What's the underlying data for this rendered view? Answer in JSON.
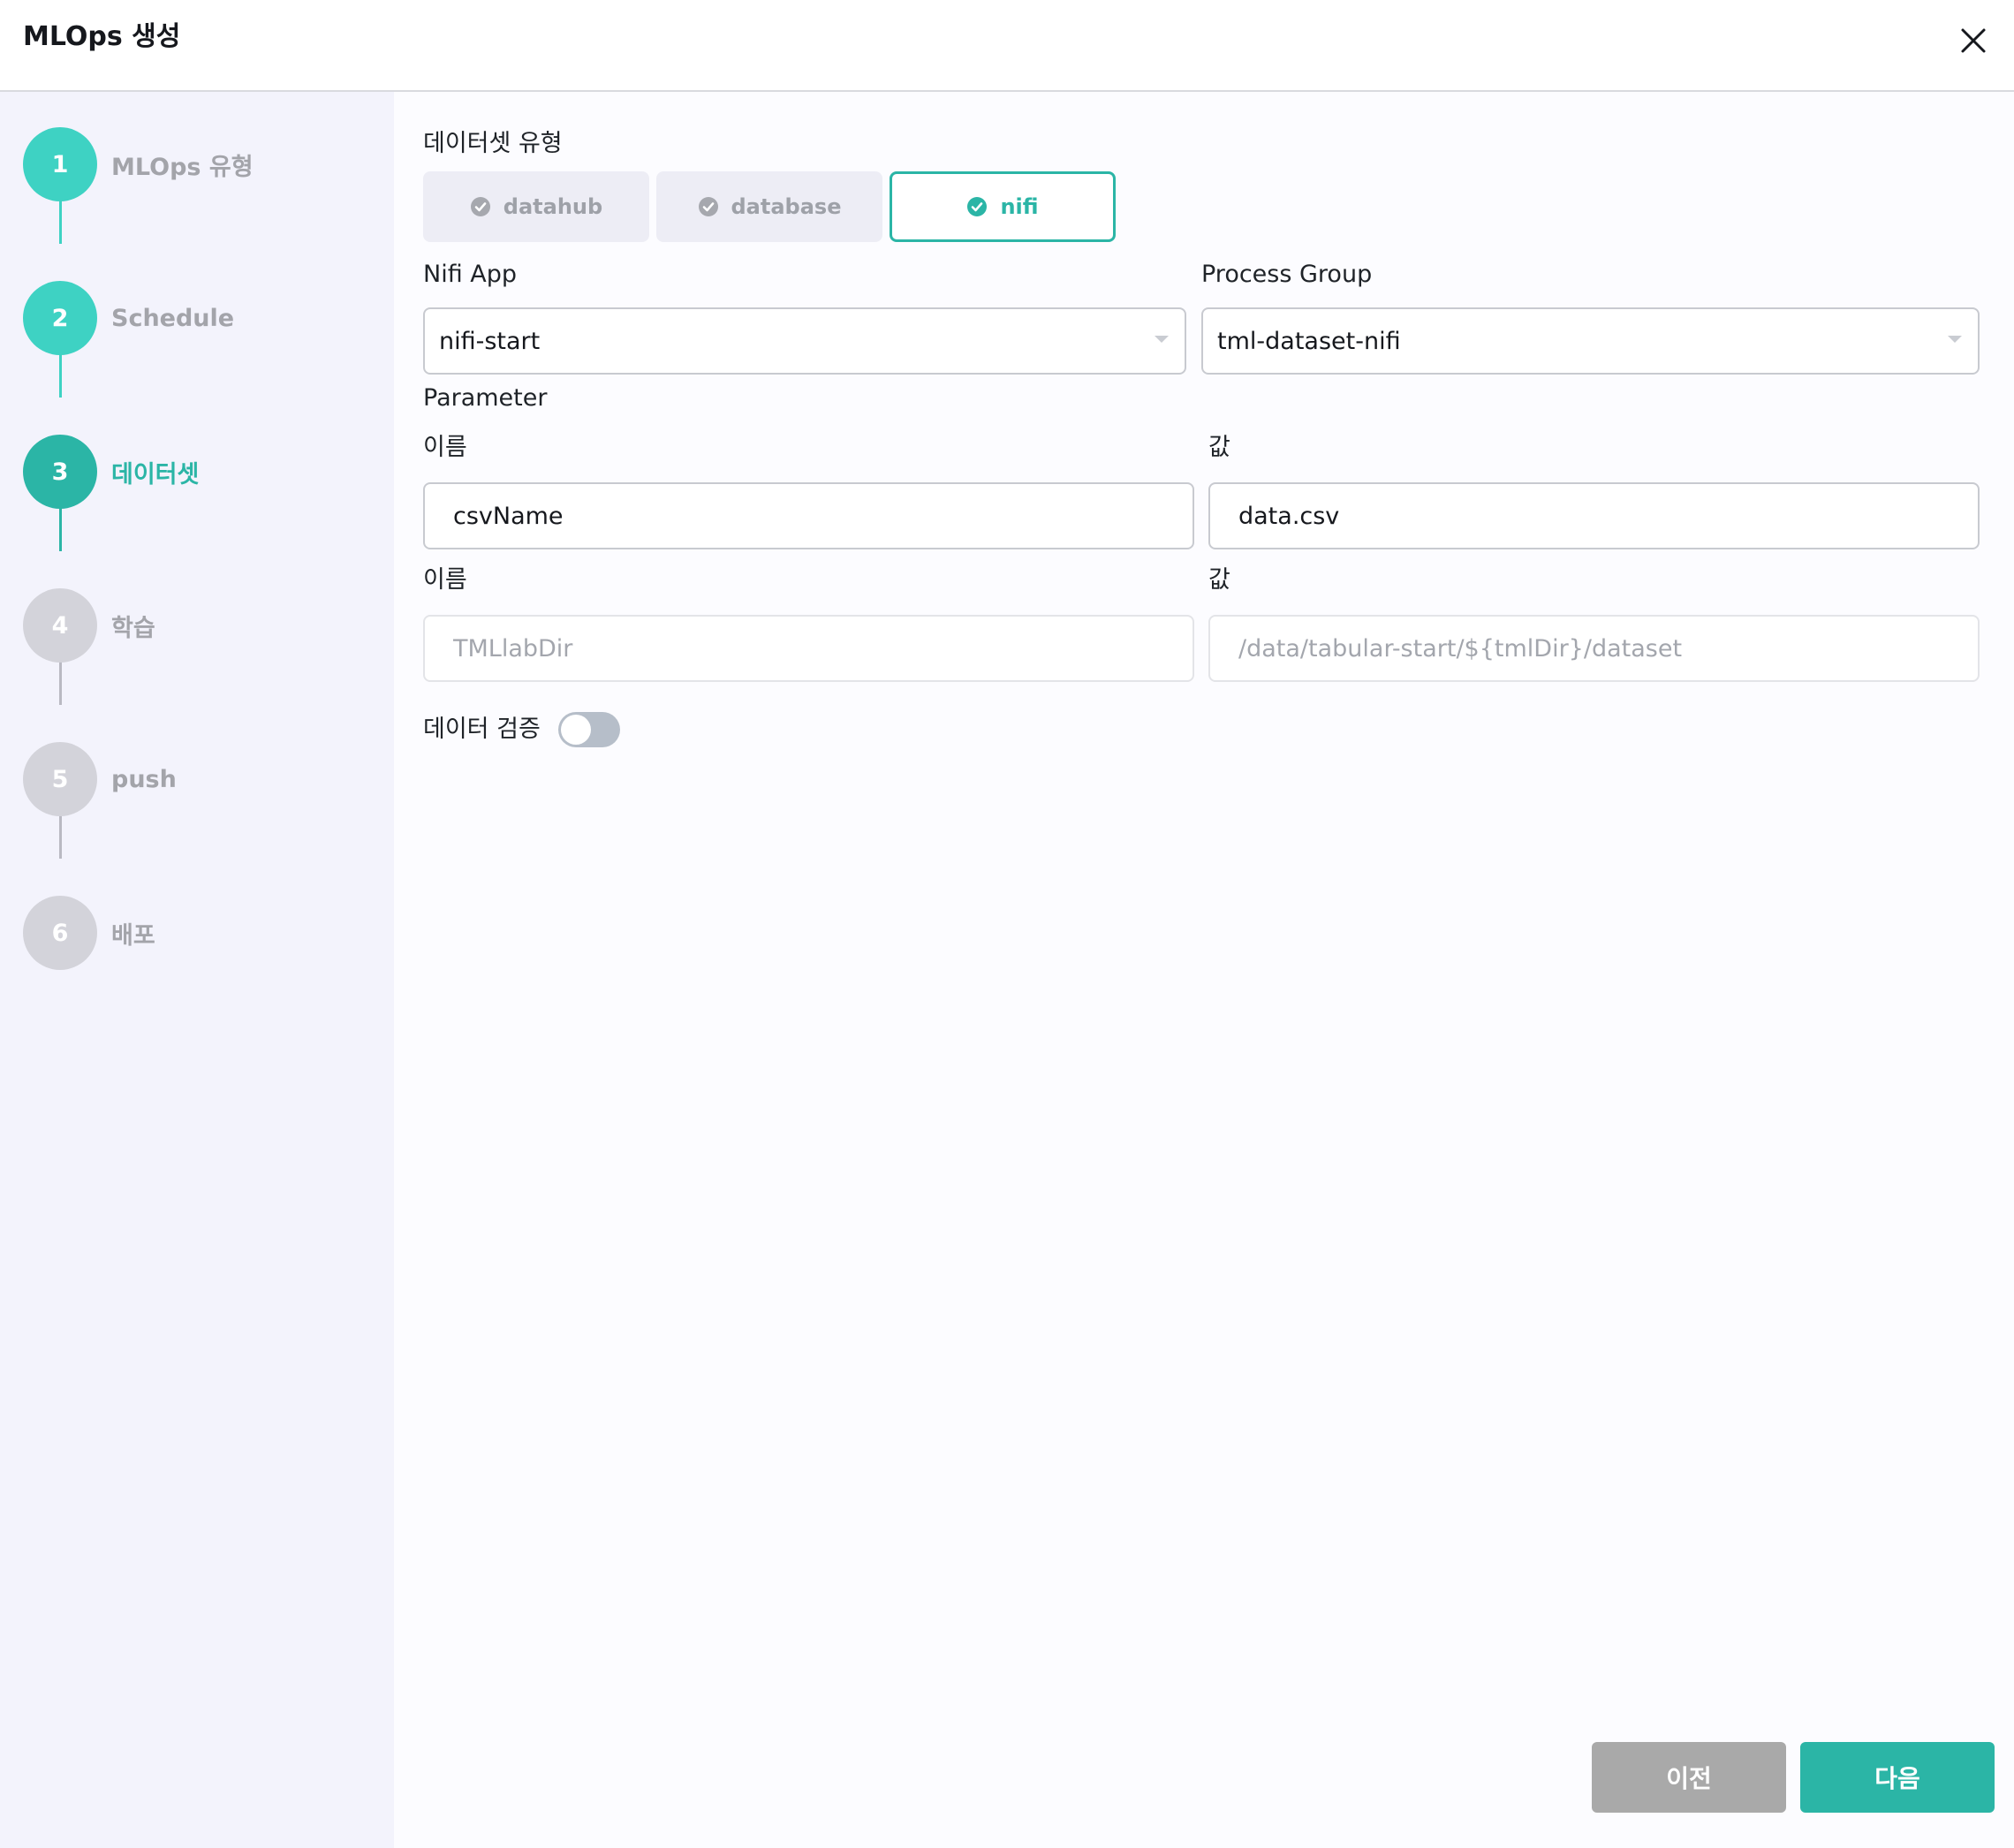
{
  "header": {
    "title": "MLOps 생성"
  },
  "steps": [
    {
      "number": "1",
      "label": "MLOps 유형",
      "status": "completed"
    },
    {
      "number": "2",
      "label": "Schedule",
      "status": "completed"
    },
    {
      "number": "3",
      "label": "데이터셋",
      "status": "active"
    },
    {
      "number": "4",
      "label": "학습",
      "status": "pending"
    },
    {
      "number": "5",
      "label": "push",
      "status": "pending"
    },
    {
      "number": "6",
      "label": "배포",
      "status": "pending"
    }
  ],
  "dataset": {
    "type_label": "데이터셋 유형",
    "types": [
      {
        "label": "datahub",
        "selected": false
      },
      {
        "label": "database",
        "selected": false
      },
      {
        "label": "nifi",
        "selected": true
      }
    ],
    "nifi_app_label": "Nifi App",
    "nifi_app_value": "nifi-start",
    "process_group_label": "Process Group",
    "process_group_value": "tml-dataset-nifi",
    "parameter_label": "Parameter",
    "params": [
      {
        "name_label": "이름",
        "value_label": "값",
        "name": "csvName",
        "value": "data.csv",
        "editable": true
      },
      {
        "name_label": "이름",
        "value_label": "값",
        "name": "TMLlabDir",
        "value": "/data/tabular-start/${tmlDir}/dataset",
        "editable": false
      }
    ],
    "validation_label": "데이터 검증",
    "validation_enabled": false
  },
  "footer": {
    "prev_label": "이전",
    "next_label": "다음"
  },
  "colors": {
    "accent": "#2bb5a6",
    "completed_step": "#3ed2c3",
    "pending_step": "#d3d3da",
    "prev_button": "#a9a9a9"
  }
}
